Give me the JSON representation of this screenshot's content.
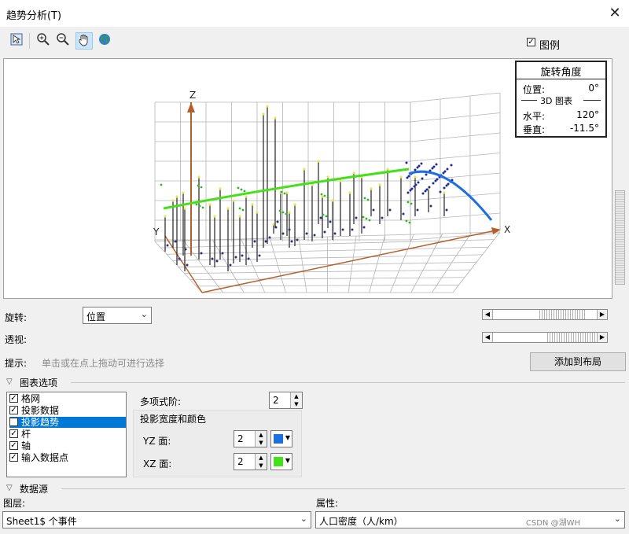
{
  "window": {
    "title": "趋势分析(T)"
  },
  "toolbar": {
    "icons": [
      "select-arrow-icon",
      "zoom-in-icon",
      "zoom-out-icon",
      "pan-hand-icon",
      "globe-icon"
    ],
    "legend_label": "图例",
    "legend_checked": true
  },
  "rotation_panel": {
    "title": "旋转角度",
    "position_label": "位置:",
    "position_value": "0°",
    "section": "3D 图表",
    "horizontal_label": "水平:",
    "horizontal_value": "120°",
    "vertical_label": "垂直:",
    "vertical_value": "-11.5°"
  },
  "plot": {
    "x_axis": "X",
    "y_axis": "Y",
    "z_axis": "Z",
    "fit_yz_color": "#1e6fe0",
    "fit_xz_color": "#44e01a"
  },
  "controls": {
    "rotate_label": "旋转:",
    "rotate_value": "位置",
    "perspective_label": "透视:",
    "hint_label": "提示:",
    "hint_text": "单击或在点上拖动可进行选择",
    "add_to_layout": "添加到布局"
  },
  "chart_options": {
    "header": "图表选项",
    "items": [
      {
        "label": "格网",
        "checked": true,
        "selected": false
      },
      {
        "label": "投影数据",
        "checked": true,
        "selected": false
      },
      {
        "label": "投影趋势",
        "checked": true,
        "selected": true
      },
      {
        "label": "杆",
        "checked": true,
        "selected": false
      },
      {
        "label": "轴",
        "checked": true,
        "selected": false
      },
      {
        "label": "输入数据点",
        "checked": true,
        "selected": false
      }
    ],
    "poly_order_label": "多项式阶:",
    "poly_order_value": "2",
    "projection_group": "投影宽度和颜色",
    "yz_label": "YZ 面:",
    "yz_value": "2",
    "yz_color": "#1e6fe0",
    "xz_label": "XZ 面:",
    "xz_value": "2",
    "xz_color": "#44e01a"
  },
  "datasource": {
    "header": "数据源",
    "layer_label": "图层:",
    "layer_value": "Sheet1$ 个事件",
    "attribute_label": "属性:",
    "attribute_value": "人口密度（人/km）"
  },
  "watermark": "CSDN @湖WH"
}
